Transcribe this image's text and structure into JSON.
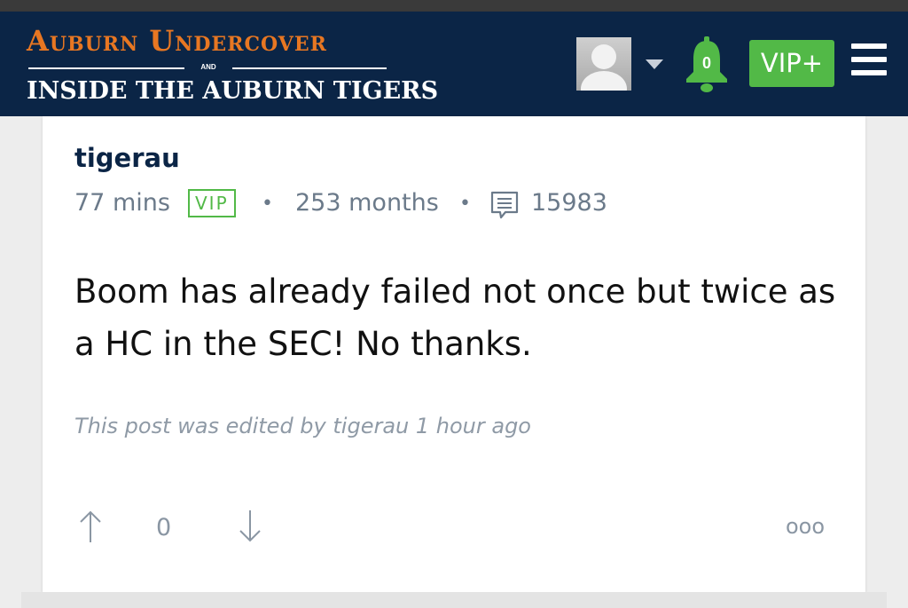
{
  "site": {
    "logo_line1": "Auburn Undercover",
    "logo_and": "AND",
    "logo_line2": "INSIDE THE AUBURN TIGERS",
    "notification_count": "0",
    "vip_button_label": "VIP+",
    "colors": {
      "navy": "#0b2546",
      "orange": "#e87722",
      "green": "#52b947"
    }
  },
  "post": {
    "author": "tigerau",
    "time_ago": "77 mins",
    "badge": "VIP",
    "member_for": "253 months",
    "post_count": "15983",
    "body": "Boom has already failed not once but twice as a HC in the SEC! No thanks.",
    "edited_note": "This post was edited by tigerau 1 hour ago",
    "vote_count": "0",
    "more_label": "ooo"
  },
  "icons": {
    "avatar": "default-avatar-icon",
    "caret": "chevron-down-icon",
    "bell": "bell-icon",
    "menu": "hamburger-menu-icon",
    "posts": "comment-icon",
    "upvote": "arrow-up-icon",
    "downvote": "arrow-down-icon"
  }
}
